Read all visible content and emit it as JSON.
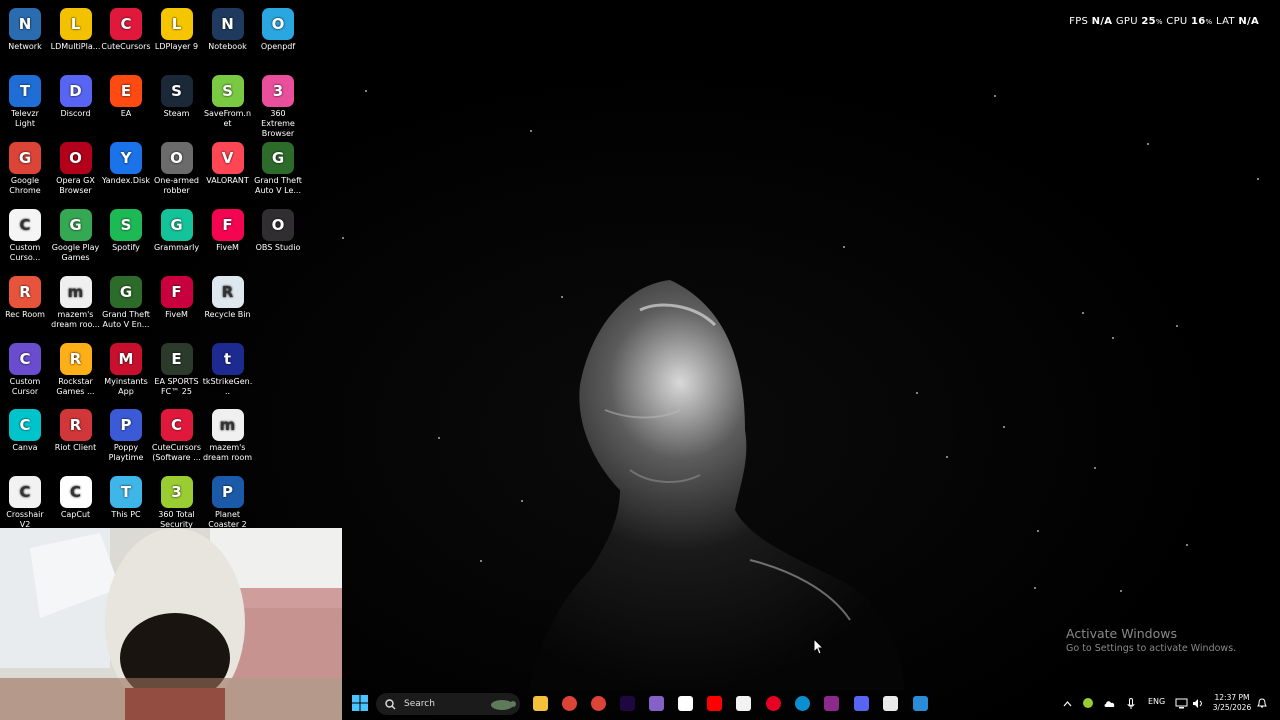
{
  "perf": {
    "fps_label": "FPS",
    "fps": "N/A",
    "gpu_label": "GPU",
    "gpu": "25",
    "cpu_label": "CPU",
    "cpu": "16",
    "lat_label": "LAT",
    "lat": "N/A",
    "unit": "%"
  },
  "desktop_icons": [
    {
      "label": "Network",
      "icon": "network-icon",
      "color": "#2b6cb0"
    },
    {
      "label": "LDMultiPla...",
      "icon": "ld-multiplayer-icon",
      "color": "#f2c200"
    },
    {
      "label": "CuteCursors",
      "icon": "cursor-icon",
      "color": "#e0193c"
    },
    {
      "label": "LDPlayer 9",
      "icon": "ldplayer-icon",
      "color": "#f5c500"
    },
    {
      "label": "Notebook",
      "icon": "notebook-icon",
      "color": "#1e3a5f"
    },
    {
      "label": "Openpdf",
      "icon": "pdf-icon",
      "color": "#2aa6e0"
    },
    {
      "label": "Televzr Light",
      "icon": "televzr-icon",
      "color": "#1e6ed6"
    },
    {
      "label": "Discord",
      "icon": "discord-icon",
      "color": "#5865f2"
    },
    {
      "label": "EA",
      "icon": "ea-icon",
      "color": "#ff4a12"
    },
    {
      "label": "Steam",
      "icon": "steam-icon",
      "color": "#1b2838"
    },
    {
      "label": "SaveFrom.net",
      "icon": "download-arrow-icon",
      "color": "#7ac943"
    },
    {
      "label": "360 Extreme Browser",
      "icon": "360-browser-icon",
      "color": "#e94f9b"
    },
    {
      "label": "Google Chrome",
      "icon": "chrome-icon",
      "color": "#db4437"
    },
    {
      "label": "Opera GX Browser",
      "icon": "opera-gx-icon",
      "color": "#b3001b"
    },
    {
      "label": "Yandex.Disk",
      "icon": "cloud-icon",
      "color": "#1a73e8"
    },
    {
      "label": "One-armed robber",
      "icon": "slot-machine-icon",
      "color": "#6b6b6b"
    },
    {
      "label": "VALORANT",
      "icon": "valorant-icon",
      "color": "#ff4655"
    },
    {
      "label": "Grand Theft Auto V Le...",
      "icon": "gta-icon",
      "color": "#2d6b2a"
    },
    {
      "label": "Custom Curso...",
      "icon": "custom-cursor-icon",
      "color": "#f5f5f5"
    },
    {
      "label": "Google Play Games",
      "icon": "play-games-icon",
      "color": "#34a853"
    },
    {
      "label": "Spotify",
      "icon": "spotify-icon",
      "color": "#1db954"
    },
    {
      "label": "Grammarly",
      "icon": "grammarly-icon",
      "color": "#15c39a"
    },
    {
      "label": "FiveM",
      "icon": "fivem-icon",
      "color": "#f40552"
    },
    {
      "label": "OBS Studio",
      "icon": "obs-icon",
      "color": "#302e31"
    },
    {
      "label": "Rec Room",
      "icon": "rec-room-icon",
      "color": "#e8543b"
    },
    {
      "label": "mazem's dream roo...",
      "icon": "file-icon",
      "color": "#f0f0f0"
    },
    {
      "label": "Grand Theft Auto V En...",
      "icon": "gta-icon",
      "color": "#2d6b2a"
    },
    {
      "label": "FiveM",
      "icon": "fivem-icon",
      "color": "#c9003d"
    },
    {
      "label": "Recycle Bin",
      "icon": "recycle-bin-icon",
      "color": "#dfe7ef"
    },
    {
      "label": "",
      "icon": "",
      "color": ""
    },
    {
      "label": "Custom Cursor",
      "icon": "custom-cursor-icon",
      "color": "#6a4ccf"
    },
    {
      "label": "Rockstar Games ...",
      "icon": "rockstar-icon",
      "color": "#fcaf17"
    },
    {
      "label": "Myinstants App",
      "icon": "myinstants-icon",
      "color": "#c8102e"
    },
    {
      "label": "EA SPORTS FC™ 25",
      "icon": "ea-fc-icon",
      "color": "#2b3a2b"
    },
    {
      "label": "tkStrikeGen...",
      "icon": "tkstrike-icon",
      "color": "#1d2a8f"
    },
    {
      "label": "",
      "icon": "",
      "color": ""
    },
    {
      "label": "Canva",
      "icon": "canva-icon",
      "color": "#00c4cc"
    },
    {
      "label": "Riot Client",
      "icon": "riot-icon",
      "color": "#d13639"
    },
    {
      "label": "Poppy Playtime",
      "icon": "poppy-icon",
      "color": "#3b5bd6"
    },
    {
      "label": "CuteCursors (Software ...",
      "icon": "cursor-icon",
      "color": "#e0193c"
    },
    {
      "label": "mazem's dream room",
      "icon": "file-icon",
      "color": "#f0f0f0"
    },
    {
      "label": "",
      "icon": "",
      "color": ""
    },
    {
      "label": "Crosshair V2",
      "icon": "crosshair-icon",
      "color": "#f2f2f2"
    },
    {
      "label": "CapCut",
      "icon": "capcut-icon",
      "color": "#ffffff"
    },
    {
      "label": "This PC",
      "icon": "monitor-icon",
      "color": "#3fb6e8"
    },
    {
      "label": "360 Total Security",
      "icon": "360-security-icon",
      "color": "#9acd32"
    },
    {
      "label": "Planet Coaster 2",
      "icon": "planet-coaster-icon",
      "color": "#1b5aa8"
    },
    {
      "label": "",
      "icon": "",
      "color": ""
    }
  ],
  "activate": {
    "title": "Activate Windows",
    "subtitle": "Go to Settings to activate Windows."
  },
  "taskbar": {
    "search_placeholder": "Search",
    "apps": [
      "explorer-icon",
      "chrome-icon",
      "chrome-icon",
      "after-effects-icon",
      "visual-studio-icon",
      "capcut-icon",
      "youtube-icon",
      "store-icon",
      "pinterest-icon",
      "edge-icon",
      "winrar-icon",
      "discord-icon",
      "file-icon",
      "shield-icon"
    ],
    "lang": "ENG",
    "time": "12:37 PM",
    "date": "3/25/2026"
  }
}
